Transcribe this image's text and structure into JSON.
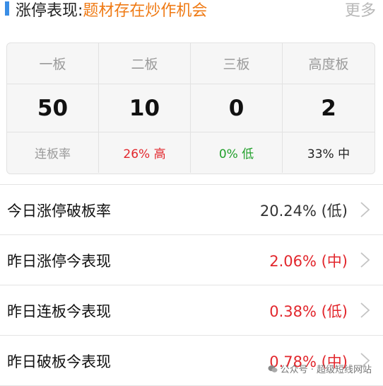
{
  "header": {
    "title_prefix": "涨停表现:",
    "title_accent": "题材存在炒作机会",
    "more_label": "更多"
  },
  "stats": {
    "columns": [
      {
        "label": "一板",
        "value": "50",
        "note": "连板率"
      },
      {
        "label": "二板",
        "value": "10",
        "note": "26% 高"
      },
      {
        "label": "三板",
        "value": "0",
        "note": "0% 低"
      },
      {
        "label": "高度板",
        "value": "2",
        "note": "33% 中"
      }
    ]
  },
  "rows": [
    {
      "label": "今日涨停破板率",
      "value": "20.24% (低)"
    },
    {
      "label": "昨日涨停今表现",
      "value": "2.06% (中)"
    },
    {
      "label": "昨日连板今表现",
      "value": "0.38% (低)"
    },
    {
      "label": "昨日破板今表现",
      "value": "0.78% (中)"
    }
  ],
  "watermark": {
    "text": "公众号 · 超级短线网站"
  },
  "colors": {
    "accent": "#ef7a14",
    "up": "#e2272d",
    "down": "#21a02b",
    "bar": "#3a8ee6"
  }
}
